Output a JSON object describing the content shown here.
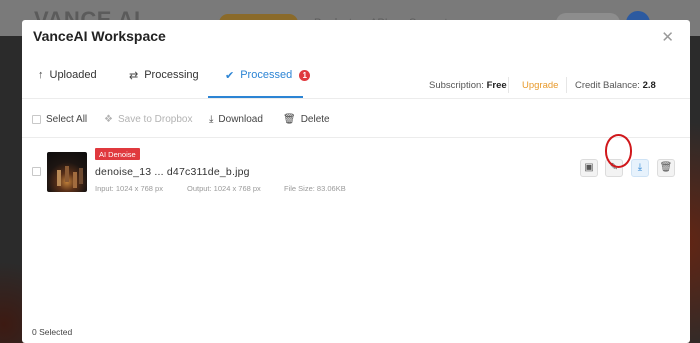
{
  "background": {
    "logo": "VANCE AI",
    "nav": [
      "Products",
      "Pricing",
      "API",
      "Support"
    ],
    "search_placeholder": "Workspace"
  },
  "modal": {
    "title": "VanceAI Workspace",
    "close_icon": "close-icon"
  },
  "tabs": [
    {
      "label": "Uploaded",
      "icon": "upload-arrow-icon",
      "active": false
    },
    {
      "label": "Processing",
      "icon": "refresh-icon",
      "active": false
    },
    {
      "label": "Processed",
      "icon": "check-circle-icon",
      "active": true,
      "badge": "1"
    }
  ],
  "subscription": {
    "label": "Subscription:",
    "plan": "Free",
    "upgrade": "Upgrade",
    "credit_label": "Credit Balance:",
    "credit_value": "2.8"
  },
  "toolbar": {
    "select_all": "Select All",
    "save_dropbox": "Save to Dropbox",
    "download": "Download",
    "delete": "Delete"
  },
  "files": [
    {
      "tag": "AI Denoise",
      "name": "denoise_13 ... d47c311de_b.jpg",
      "input": "Input: 1024 x 768 px",
      "output": "Output: 1024 x 768 px",
      "size": "File Size: 83.06KB"
    }
  ],
  "footer": {
    "selected": "0 Selected"
  },
  "colors": {
    "accent": "#2c84d4",
    "upgrade": "#e89a2c",
    "badge": "#e0393e",
    "tag": "#e0393e",
    "highlight": "#d0181c"
  }
}
